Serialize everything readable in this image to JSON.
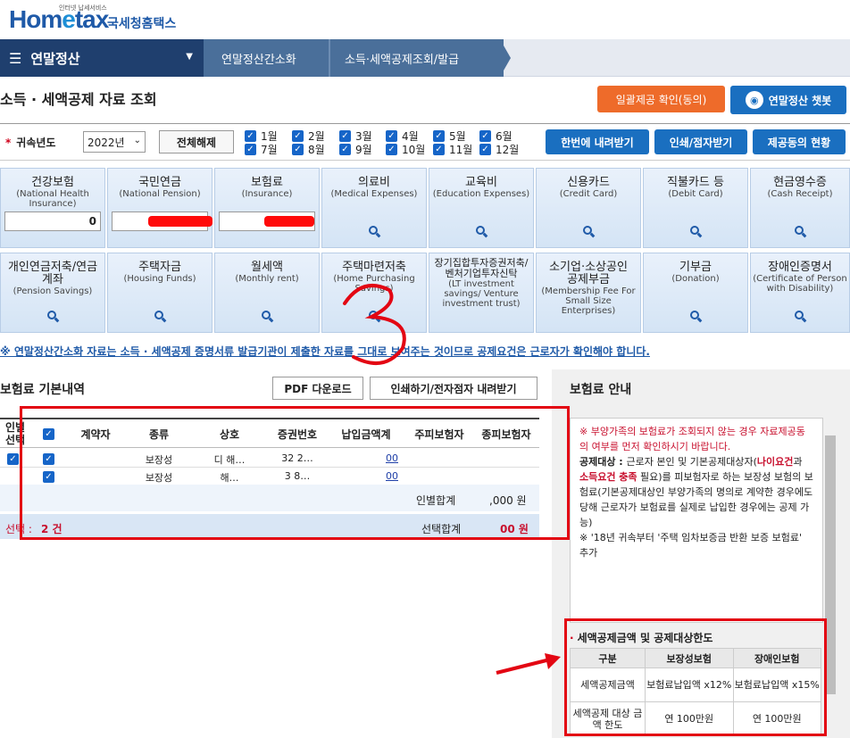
{
  "logo": {
    "brand_prefix": "Hom",
    "brand_e": "e",
    "brand_suffix": "tax",
    "tagline": "인터넷 납세서비스",
    "name_kr": "국세청홈택스"
  },
  "nav": {
    "menu": "연말정산",
    "crumb1": "연말정산간소화",
    "crumb2": "소득·세액공제조회/발급"
  },
  "page": {
    "title": "소득 · 세액공제 자료 조회"
  },
  "buttons": {
    "bulk": "일괄제공 확인(동의)",
    "chatbot": "연말정산 챗봇",
    "toggle": "전체해제",
    "download_all": "한번에 내려받기",
    "print": "인쇄/점자받기",
    "status": "제공동의 현황"
  },
  "filter": {
    "year_label": "귀속년도",
    "year_value": "2022년",
    "months": [
      "1월",
      "2월",
      "3월",
      "4월",
      "5월",
      "6월",
      "7월",
      "8월",
      "9월",
      "10월",
      "11월",
      "12월"
    ]
  },
  "tiles_row1": [
    {
      "kr": "건강보험",
      "en": "(National Health Insurance)",
      "value": "0"
    },
    {
      "kr": "국민연금",
      "en": "(National Pension)",
      "value": ""
    },
    {
      "kr": "보험료",
      "en": "(Insurance)",
      "value": ""
    },
    {
      "kr": "의료비",
      "en": "(Medical Expenses)"
    },
    {
      "kr": "교육비",
      "en": "(Education Expenses)"
    },
    {
      "kr": "신용카드",
      "en": "(Credit Card)"
    },
    {
      "kr": "직불카드 등",
      "en": "(Debit Card)"
    },
    {
      "kr": "현금영수증",
      "en": "(Cash Receipt)"
    }
  ],
  "tiles_row2": [
    {
      "kr": "개인연금저축/연금계좌",
      "en": "(Pension Savings)"
    },
    {
      "kr": "주택자금",
      "en": "(Housing Funds)"
    },
    {
      "kr": "월세액",
      "en": "(Monthly rent)"
    },
    {
      "kr": "주택마련저축",
      "en": "(Home Purchasing Savings)"
    },
    {
      "kr": "장기집합투자증권저축/벤처기업투자신탁",
      "en": "(LT investment savings/ Venture investment trust)"
    },
    {
      "kr": "소기업·소상공인 공제부금",
      "en": "(Membership Fee For Small Size Enterprises)"
    },
    {
      "kr": "기부금",
      "en": "(Donation)"
    },
    {
      "kr": "장애인증명서",
      "en": "(Certificate of Person with Disability)"
    }
  ],
  "notice": "※ 연말정산간소화 자료는 소득 · 세액공제 증명서류 발급기관이 제출한 자료를 그대로 보여주는 것이므로 공제요건은 근로자가 확인해야 합니다.",
  "section": {
    "title": "보험료 기본내역",
    "pdf": "PDF 다운로드",
    "print_btn": "인쇄하기/전자점자 내려받기"
  },
  "table": {
    "headers": [
      "인별선택",
      "",
      "계약자",
      "종류",
      "상호",
      "증권번호",
      "납입금액계",
      "주피보험자",
      "종피보험자"
    ],
    "rows": [
      {
        "contractor": "",
        "type": "보장성",
        "company": "디 해…",
        "policy": "32 2…",
        "amount": "00",
        "main": "",
        "sub": ""
      },
      {
        "contractor": "",
        "type": "보장성",
        "company": "해…",
        "policy": "3 8…",
        "amount": "00",
        "main": "",
        "sub": ""
      }
    ],
    "person_sum_label": "인별합계",
    "person_sum_value": ",000 원",
    "selected_label": "선택 :",
    "selected_count": "2 건",
    "selected_sum_label": "선택합계",
    "selected_sum_value": "00 원"
  },
  "guide": {
    "panel_title": "보험료 안내",
    "p1": "※ 부양가족의 보험료가 조회되지 않는 경우 자료제공동의 여부를 먼저 확인하시기 바랍니다.",
    "p2_a": "공제대상 : ",
    "p2_b": "근로자 본인 및 기본공제대상자(",
    "p2_c": "나이요건",
    "p2_d": "과 ",
    "p2_e": "소득요건 충족",
    "p2_f": " 필요)를 피보험자로 하는 보장성 보험의 보험료(기본공제대상인 부양가족의 명의로 계약한 경우에도 당해 근로자가 보험료를 실제로 납입한 경우에는 공제 가능)",
    "p3": "※ '18년 귀속부터 '주택 임차보증금 반환 보증 보험료' 추가"
  },
  "limit": {
    "title": "세액공제금액 및 공제대상한도",
    "headers": [
      "구분",
      "보장성보험",
      "장애인보험"
    ],
    "rows": [
      [
        "세액공제금액",
        "보험료납입액 x12%",
        "보험료납입액 x15%"
      ],
      [
        "세액공제 대상 금액 한도",
        "연 100만원",
        "연 100만원"
      ]
    ]
  },
  "annotation": {
    "mark": "3"
  },
  "colors": {
    "accent": "#e30613",
    "brand": "#1f5aa8",
    "nav": "#1f3f6e"
  }
}
